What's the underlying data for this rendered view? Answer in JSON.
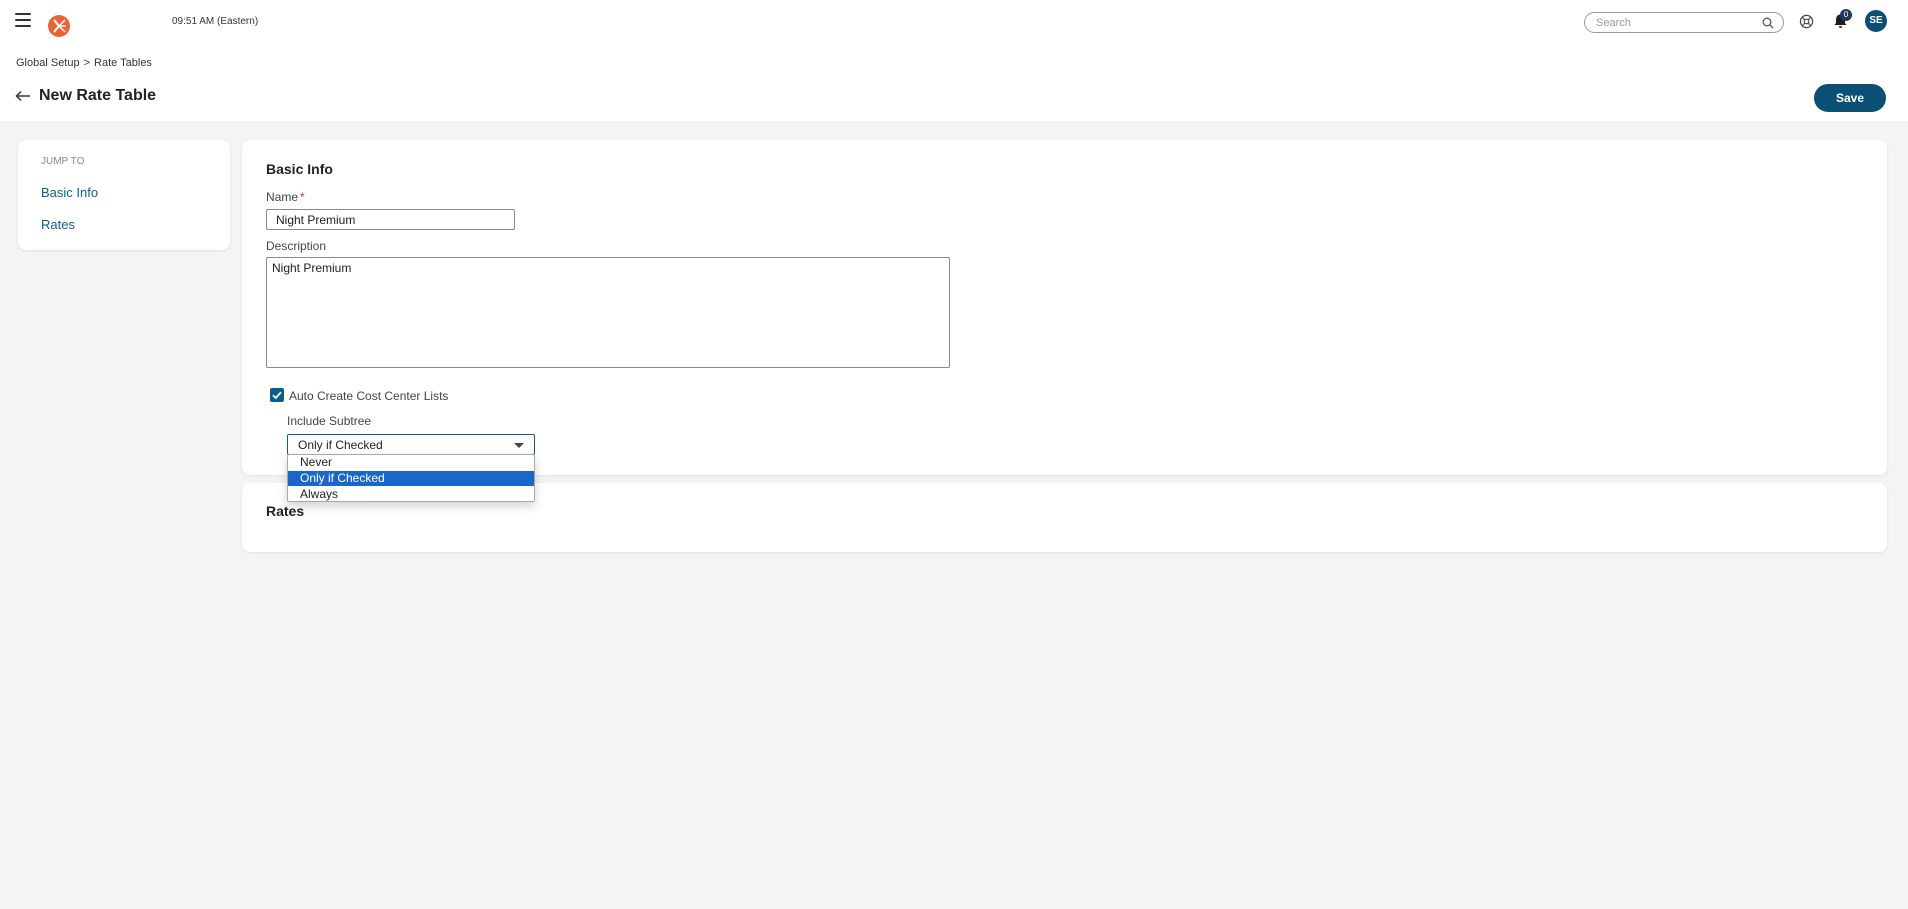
{
  "topbar": {
    "time": "09:51 AM (Eastern)",
    "search_placeholder": "Search",
    "notification_count": "0",
    "avatar_initials": "SE"
  },
  "breadcrumb": {
    "items": [
      "Global Setup",
      "Rate Tables"
    ],
    "separator": ">"
  },
  "header": {
    "title": "New Rate Table",
    "save_label": "Save"
  },
  "jump_to": {
    "label": "JUMP TO",
    "links": [
      "Basic Info",
      "Rates"
    ]
  },
  "basic_info": {
    "title": "Basic Info",
    "name_label": "Name",
    "required_mark": "*",
    "name_value": "Night Premium",
    "description_label": "Description",
    "description_value": "Night Premium",
    "auto_create_label": "Auto Create Cost Center Lists",
    "auto_create_checked": true,
    "include_subtree_label": "Include Subtree",
    "include_subtree_value": "Only if Checked",
    "include_subtree_options": [
      "Never",
      "Only if Checked",
      "Always"
    ]
  },
  "rates": {
    "title": "Rates"
  },
  "colors": {
    "accent": "#0b4f75",
    "link": "#0b5e8a",
    "selected_option": "#1b66c9",
    "logo": "#e8643a"
  }
}
